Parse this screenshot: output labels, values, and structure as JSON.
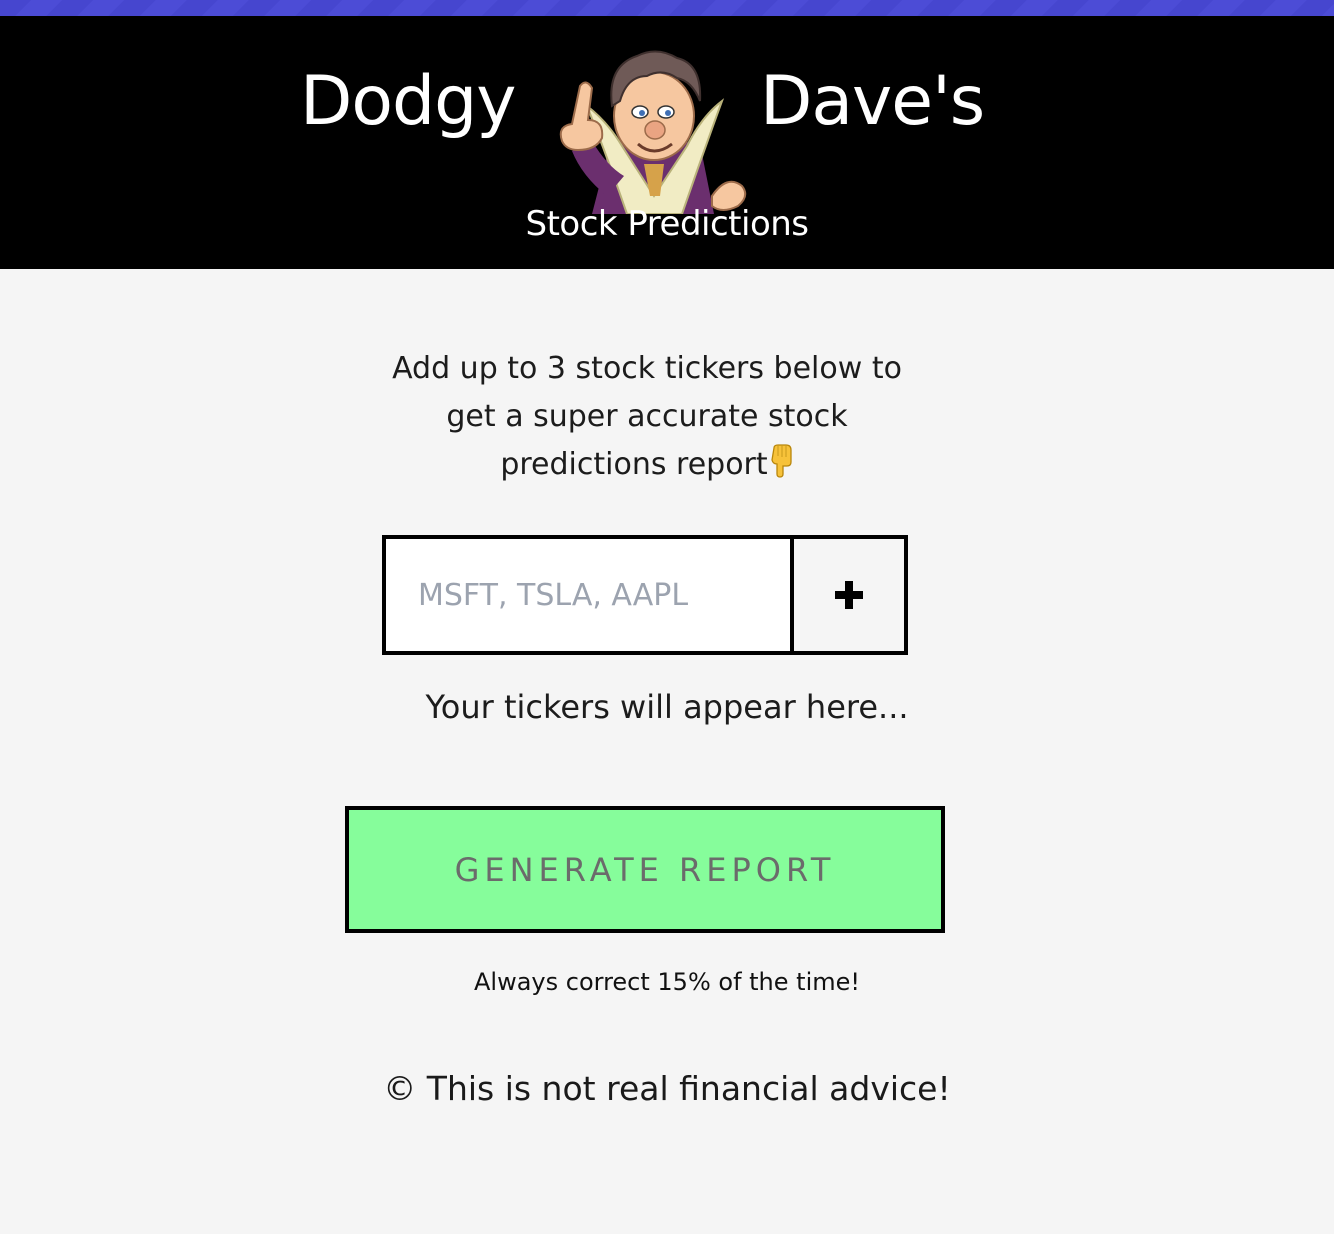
{
  "header": {
    "brand_left": "Dodgy",
    "brand_right": "Dave's",
    "subtitle": "Stock Predictions",
    "background_color": "#000000",
    "accent_strip_color": "#4646cf",
    "mascot_icon": "mascot-icon"
  },
  "main": {
    "intro_text": "Add up to 3 stock tickers below to get a super accurate stock predictions report",
    "intro_emoji_icon": "pointing-down-hand-icon",
    "ticker_input": {
      "placeholder": "MSFT, TSLA, AAPL",
      "value": ""
    },
    "add_button_icon": "plus-icon",
    "tickers_hint": "Your tickers will appear here...",
    "generate_button_label": "GENERATE REPORT",
    "generate_button_color": "#86fd9b",
    "tagline": "Always correct 15% of the time!"
  },
  "footer": {
    "note": "© This is not real financial advice!"
  }
}
